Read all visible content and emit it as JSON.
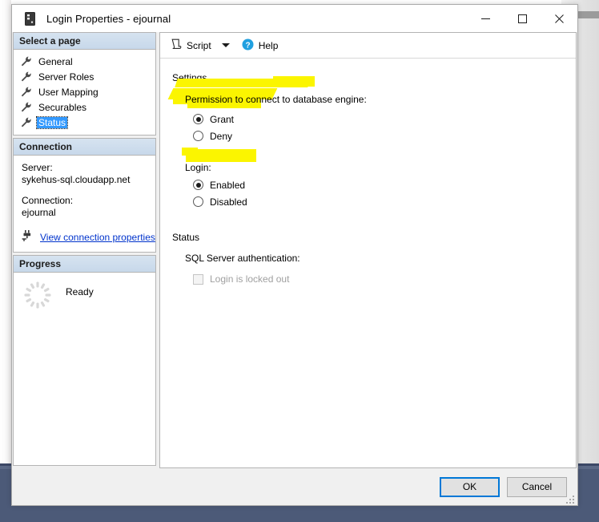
{
  "window": {
    "title": "Login Properties - ejournal",
    "icon": "server-icon",
    "minimize_label": "Minimize",
    "maximize_label": "Maximize",
    "close_label": "Close"
  },
  "sidebar": {
    "header": "Select a page",
    "items": [
      {
        "label": "General",
        "icon": "wrench-icon",
        "selected": false
      },
      {
        "label": "Server Roles",
        "icon": "wrench-icon",
        "selected": false
      },
      {
        "label": "User Mapping",
        "icon": "wrench-icon",
        "selected": false
      },
      {
        "label": "Securables",
        "icon": "wrench-icon",
        "selected": false
      },
      {
        "label": "Status",
        "icon": "wrench-icon",
        "selected": true
      }
    ]
  },
  "connection": {
    "header": "Connection",
    "server_label": "Server:",
    "server_value": "sykehus-sql.cloudapp.net",
    "connection_label": "Connection:",
    "connection_value": "ejournal",
    "link_label": "View connection properties",
    "link_icon": "plug-icon"
  },
  "progress": {
    "header": "Progress",
    "status": "Ready",
    "icon": "spinner-icon"
  },
  "toolbar": {
    "script_label": "Script",
    "script_icon": "script-icon",
    "script_caret": "chevron-down-icon",
    "help_label": "Help",
    "help_icon": "help-circle-icon"
  },
  "main": {
    "settings_title": "Settings",
    "permission_label": "Permission to connect to database engine:",
    "permission_options": [
      {
        "label": "Grant",
        "selected": true
      },
      {
        "label": "Deny",
        "selected": false
      }
    ],
    "login_label": "Login:",
    "login_options": [
      {
        "label": "Enabled",
        "selected": true
      },
      {
        "label": "Disabled",
        "selected": false
      }
    ],
    "status_title": "Status",
    "auth_label": "SQL Server authentication:",
    "locked_out_label": "Login is locked out",
    "locked_out_checked": false,
    "locked_out_disabled": true
  },
  "footer": {
    "ok_label": "OK",
    "cancel_label": "Cancel"
  },
  "annotations": {
    "highlight_color": "#fbf500",
    "marks": [
      "permission-label-highlight",
      "grant-option-highlight",
      "enabled-option-highlight"
    ]
  }
}
